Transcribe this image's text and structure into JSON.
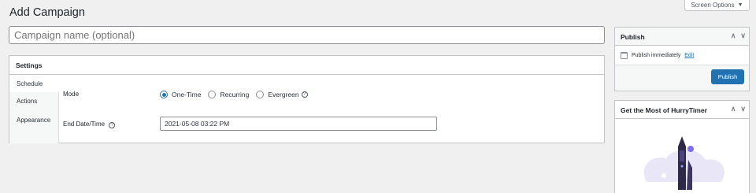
{
  "page": {
    "title": "Add Campaign"
  },
  "screen_options": {
    "label": "Screen Options",
    "arrow": "▼"
  },
  "campaign_name": {
    "placeholder": "Campaign name (optional)"
  },
  "settings": {
    "title": "Settings",
    "tabs": [
      "Schedule",
      "Actions",
      "Appearance"
    ],
    "mode_label": "Mode",
    "modes": [
      "One-Time",
      "Recurring",
      "Evergreen"
    ],
    "selected_mode": "One-Time",
    "end_label": "End Date/Time",
    "end_value": "2021-05-08 03:22 PM",
    "help_glyph": "?"
  },
  "publish": {
    "title": "Publish",
    "status_text": "Publish immediately",
    "edit_link": "Edit",
    "button": "Publish",
    "calendar_icon": "calendar-icon"
  },
  "promo": {
    "title": "Get the Most of HurryTimer"
  },
  "controls": {
    "up": "∧",
    "down": "∨"
  },
  "colors": {
    "accent": "#2271b1",
    "background": "#f0f0f1",
    "border": "#c3c4c7"
  }
}
